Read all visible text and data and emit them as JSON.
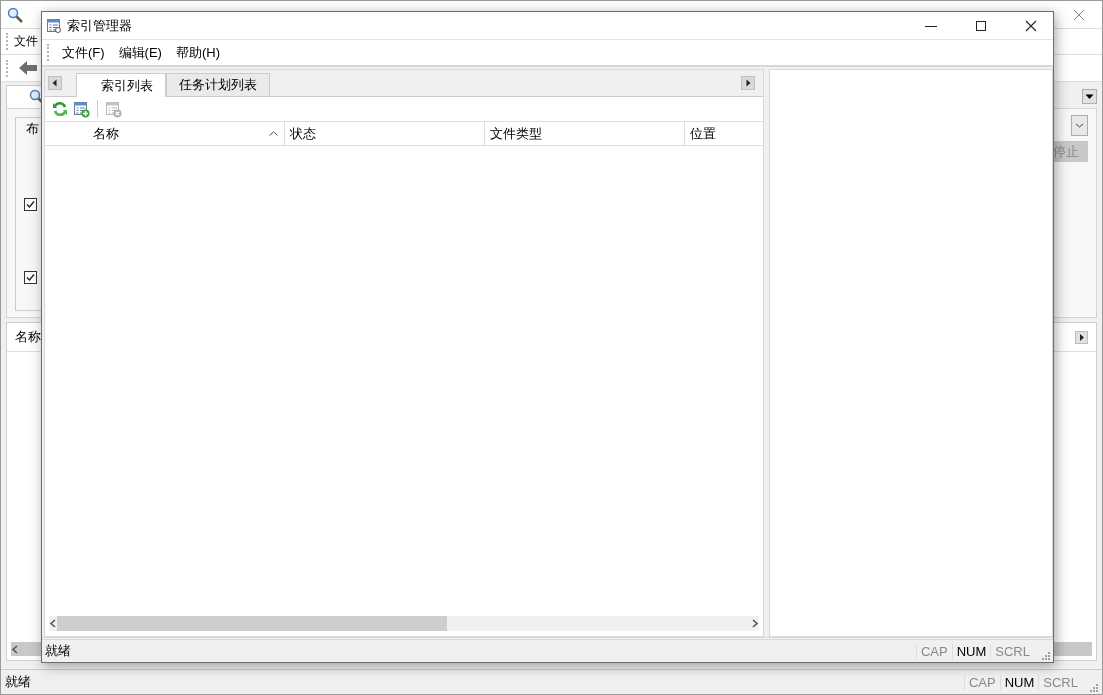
{
  "background_window": {
    "menu": [
      {
        "label": "文件"
      }
    ],
    "group_label": "布",
    "checkboxes": [
      {
        "checked": true
      },
      {
        "checked": true
      }
    ],
    "stop_button": {
      "label": "停止",
      "disabled": true
    },
    "list_columns": [
      {
        "label": "名称"
      }
    ],
    "status_bar": {
      "text": "就绪",
      "indicators": [
        {
          "label": "CAP",
          "on": false
        },
        {
          "label": "NUM",
          "on": true
        },
        {
          "label": "SCRL",
          "on": false
        }
      ]
    }
  },
  "dialog": {
    "title": "索引管理器",
    "menu": [
      {
        "label": "文件(F)"
      },
      {
        "label": "编辑(E)"
      },
      {
        "label": "帮助(H)"
      }
    ],
    "tabs": [
      {
        "label": "索引列表",
        "selected": true
      },
      {
        "label": "任务计划列表",
        "selected": false
      }
    ],
    "toolbar": [
      {
        "kind": "refresh",
        "disabled": false
      },
      {
        "kind": "add",
        "disabled": false
      },
      {
        "kind": "separator"
      },
      {
        "kind": "delete",
        "disabled": true
      }
    ],
    "columns": [
      {
        "label": "名称",
        "sorted_ascending": true
      },
      {
        "label": "状态",
        "sorted_ascending": false
      },
      {
        "label": "文件类型",
        "sorted_ascending": false
      },
      {
        "label": "位置",
        "sorted_ascending": false
      }
    ],
    "status_bar": {
      "text": "就绪",
      "indicators": [
        {
          "label": "CAP",
          "on": false
        },
        {
          "label": "NUM",
          "on": true
        },
        {
          "label": "SCRL",
          "on": false
        }
      ]
    }
  }
}
